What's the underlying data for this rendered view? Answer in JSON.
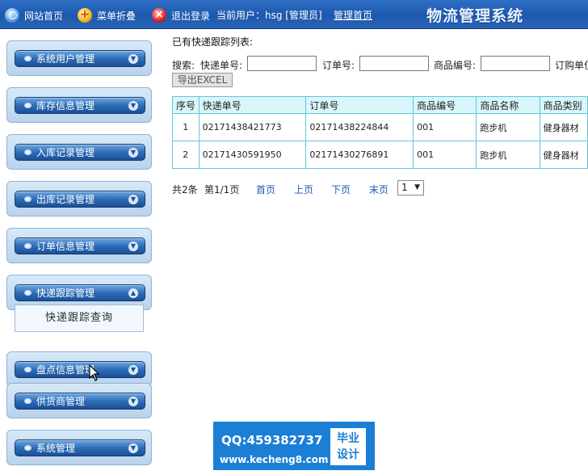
{
  "header": {
    "home_label": "网站首页",
    "menu_toggle_label": "菜单折叠",
    "logout_label": "退出登录",
    "current_user": "当前用户：hsg [管理员]",
    "admin_home_label": "管理首页",
    "system_title": "物流管理系统"
  },
  "sidebar": {
    "items": [
      {
        "label": "系统用户管理"
      },
      {
        "label": "库存信息管理"
      },
      {
        "label": "入库记录管理"
      },
      {
        "label": "出库记录管理"
      },
      {
        "label": "订单信息管理"
      },
      {
        "label": "快递跟踪管理",
        "expanded": true
      },
      {
        "label": "盘点信息管理"
      },
      {
        "label": "供货商管理"
      },
      {
        "label": "系统管理"
      }
    ],
    "submenu_label": "快递跟踪查询"
  },
  "main": {
    "list_heading": "已有快递跟踪列表:",
    "search": {
      "label": "搜索:",
      "tracking_no_label": "快递单号:",
      "tracking_no_value": "",
      "order_no_label": "订单号:",
      "order_no_value": "",
      "product_code_label": "商品编号:",
      "product_code_value": "",
      "order_unit_label": "订购单位"
    },
    "export_label": "导出EXCEL",
    "table": {
      "headers": [
        "序号",
        "快递单号",
        "订单号",
        "商品编号",
        "商品名称",
        "商品类别"
      ],
      "rows": [
        [
          "1",
          "02171438421773",
          "02171438224844",
          "001",
          "跑步机",
          "健身器材"
        ],
        [
          "2",
          "02171430591950",
          "02171430276891",
          "001",
          "跑步机",
          "健身器材"
        ]
      ]
    },
    "pager": {
      "total": "共2条",
      "page_info": "第1/1页",
      "first": "首页",
      "prev": "上页",
      "next": "下页",
      "last": "末页",
      "page_select": "1"
    }
  },
  "watermark": {
    "qq": "QQ:459382737",
    "url": "www.kecheng8.com",
    "badge_line1": "毕业",
    "badge_line2": "设计"
  }
}
